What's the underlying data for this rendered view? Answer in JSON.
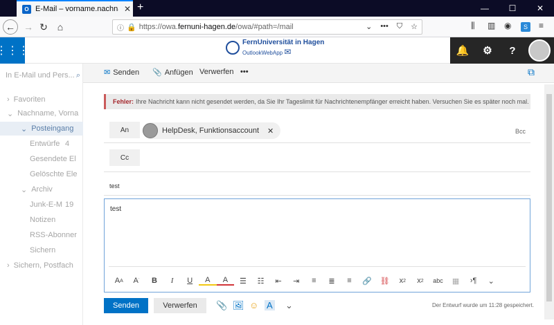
{
  "browser": {
    "tab_title": "E-Mail – vorname.nachname@",
    "tab_icon_label": "O",
    "url_prefix": "https://owa.",
    "url_domain": "fernuni-hagen.de",
    "url_suffix": "/owa/#path=/mail"
  },
  "header": {
    "logo_name": "FernUniversität in Hagen",
    "logo_sub": "OutlookWebApp"
  },
  "leftnav": {
    "search_placeholder": "In E-Mail und Pers...",
    "items": [
      {
        "label": "Favoriten",
        "prefix": "›"
      },
      {
        "label": "Nachname, Vorna",
        "prefix": "⌄"
      },
      {
        "label": "Posteingang",
        "prefix": "⌄"
      },
      {
        "label": "Entwürfe",
        "count": "4"
      },
      {
        "label": "Gesendete El"
      },
      {
        "label": "Gelöschte Ele"
      },
      {
        "label": "Archiv",
        "prefix": "⌄"
      },
      {
        "label": "Junk-E-M",
        "count": "19"
      },
      {
        "label": "Notizen"
      },
      {
        "label": "RSS-Abonner"
      },
      {
        "label": "Sichern"
      },
      {
        "label": "Sichern, Postfach",
        "prefix": "›"
      }
    ]
  },
  "toolbar": {
    "send": "Senden",
    "attach": "Anfügen",
    "discard": "Verwerfen",
    "more": "•••"
  },
  "compose": {
    "error_label": "Fehler:",
    "error_text": "Ihre Nachricht kann nicht gesendet werden, da Sie Ihr Tageslimit für Nachrichtenempfänger erreicht haben. Versuchen Sie es später noch mal.",
    "to_label": "An",
    "cc_label": "Cc",
    "bcc_label": "Bcc",
    "recipient": "HelpDesk, Funktionsaccount",
    "subject": "test",
    "body": "test",
    "send_button": "Senden",
    "discard_button": "Verwerfen",
    "draft_status": "Der Entwurf wurde um 11:28 gespeichert."
  },
  "colors": {
    "accent": "#0072c6",
    "header_dark": "#262626",
    "error": "#a4262c"
  }
}
